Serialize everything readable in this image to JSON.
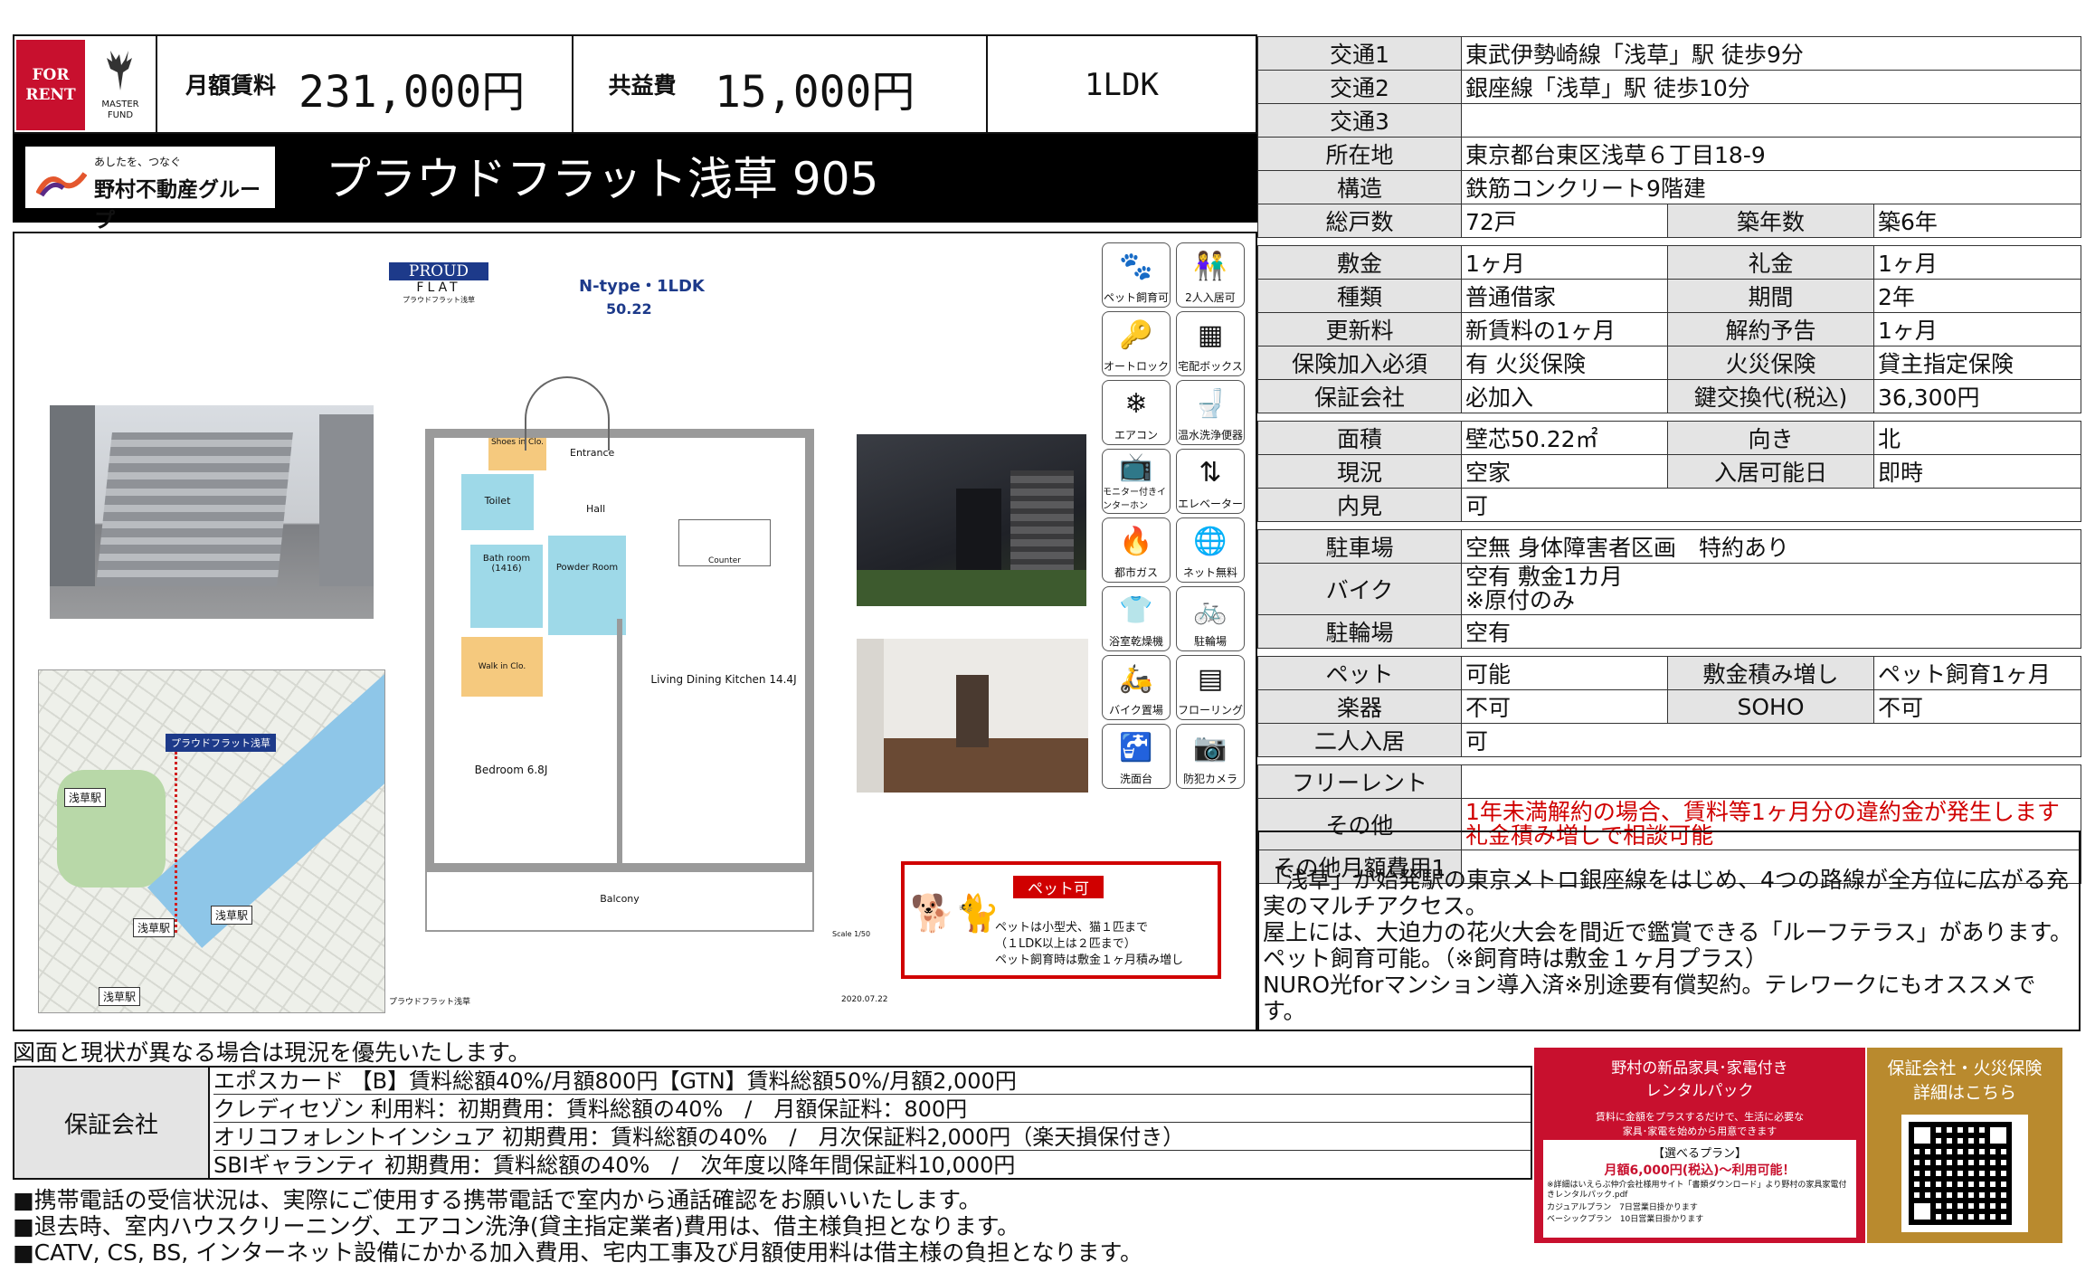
{
  "logo": {
    "for_rent": "FOR RENT",
    "brand": "MASTER FUND",
    "group_tag": "あしたを、つなぐ",
    "group_name": "野村不動産グループ"
  },
  "header": {
    "rent_label": "月額賃料",
    "rent_value": "231,000円",
    "fee_label": "共益費",
    "fee_value": "15,000円",
    "layout": "1LDK",
    "property_name": "プラウドフラット浅草 905"
  },
  "specs": {
    "top": [
      {
        "k": "交通1",
        "v": "東武伊勢崎線「浅草」駅 徒歩9分"
      },
      {
        "k": "交通2",
        "v": "銀座線「浅草」駅 徒歩10分"
      },
      {
        "k": "交通3",
        "v": ""
      },
      {
        "k": "所在地",
        "v": "東京都台東区浅草６丁目18-9"
      },
      {
        "k": "構造",
        "v": "鉄筋コンクリート9階建"
      }
    ],
    "units_label": "総戸数",
    "units_value": "72戸",
    "age_label": "築年数",
    "age_value": "築6年",
    "contract": [
      {
        "k1": "敷金",
        "v1": "1ヶ月",
        "k2": "礼金",
        "v2": "1ヶ月"
      },
      {
        "k1": "種類",
        "v1": "普通借家",
        "k2": "期間",
        "v2": "2年"
      },
      {
        "k1": "更新料",
        "v1": "新賃料の1ヶ月",
        "k2": "解約予告",
        "v2": "1ヶ月"
      },
      {
        "k1": "保険加入必須",
        "v1": "有 火災保険",
        "k2": "火災保険",
        "v2": "貸主指定保険"
      },
      {
        "k1": "保証会社",
        "v1": "必加入",
        "k2": "鍵交換代(税込)",
        "v2": "36,300円"
      }
    ],
    "room": [
      {
        "k1": "面積",
        "v1": "壁芯50.22㎡",
        "k2": "向き",
        "v2": "北"
      },
      {
        "k1": "現況",
        "v1": "空家",
        "k2": "入居可能日",
        "v2": "即時"
      }
    ],
    "viewing_label": "内見",
    "viewing_value": "可",
    "parking_label": "駐車場",
    "parking_value": "空無 身体障害者区画　特約あり",
    "bike_label": "バイク",
    "bike_value1": "空有 敷金1カ月",
    "bike_value2": "※原付のみ",
    "bicycle_label": "駐輪場",
    "bicycle_value": "空有",
    "pet_label": "ペット",
    "pet_value": "可能",
    "pet_deposit_label": "敷金積み増し",
    "pet_deposit_value": "ペット飼育1ヶ月",
    "instrument_label": "楽器",
    "instrument_value": "不可",
    "soho_label": "SOHO",
    "soho_value": "不可",
    "couple_label": "二人入居",
    "couple_value": "可",
    "freerent_label": "フリーレント",
    "freerent_value": "",
    "other_label": "その他",
    "other_value1": "1年未満解約の場合、賃料等1ヶ月分の違約金が発生します",
    "other_value2": "礼金積み増しで相談可能",
    "other_fee_label": "その他月額費用1"
  },
  "description": [
    "「浅草」が始発駅の東京メトロ銀座線をはじめ、4つの路線が全方位に広がる充実のマルチアクセス。",
    "屋上には、大迫力の花火大会を間近で鑑賞できる「ルーフテラス」があります。",
    "ペット飼育可能。（※飼育時は敷金１ヶ月プラス）",
    "NURO光forマンション導入済※別途要有償契約。テレワークにもオススメです。"
  ],
  "floorplan": {
    "brand": "PROUD",
    "brand2": "FLAT",
    "brand3": "プラウドフラット浅草",
    "type": "N-type・1LDK",
    "area": "50.22",
    "rooms": [
      "Shoes in Clo.",
      "Entrance",
      "Toilet",
      "Hall",
      "Bath room (1416)",
      "Powder Room",
      "Counter",
      "Walk in Clo.",
      "Living Dining Kitchen 14.4J",
      "Bedroom 6.8J",
      "Balcony"
    ],
    "scale": "Scale 1/50",
    "date": "2020.07.22",
    "caption": "プラウドフラット浅草",
    "map_label": "プラウドフラット浅草",
    "map_stations": [
      "浅草駅",
      "浅草駅",
      "浅草駅",
      "浅草駅"
    ]
  },
  "pet_box": {
    "title": "ペット可",
    "l1": "ペットは小型犬、猫１匹まで",
    "l2": "（１LDK以上は２匹まで）",
    "l3": "ペット飼育時は敷金１ヶ月積み増し"
  },
  "amenities": [
    {
      "label": "ペット飼育可",
      "icon": "pet-icon",
      "glyph": "🐾"
    },
    {
      "label": "2人入居可",
      "icon": "couple-icon",
      "glyph": "👫"
    },
    {
      "label": "オートロック",
      "icon": "key-icon",
      "glyph": "🔑"
    },
    {
      "label": "宅配ボックス",
      "icon": "parcel-box-icon",
      "glyph": "▦"
    },
    {
      "label": "エアコン",
      "icon": "aircon-icon",
      "glyph": "❄"
    },
    {
      "label": "温水洗浄便器",
      "icon": "toilet-icon",
      "glyph": "🚽"
    },
    {
      "label": "モニター付きインターホン",
      "icon": "intercom-icon",
      "glyph": "📺"
    },
    {
      "label": "エレベーター",
      "icon": "elevator-icon",
      "glyph": "⇅"
    },
    {
      "label": "都市ガス",
      "icon": "gas-icon",
      "glyph": "🔥"
    },
    {
      "label": "ネット無料",
      "icon": "internet-icon",
      "glyph": "🌐"
    },
    {
      "label": "浴室乾燥機",
      "icon": "bath-dryer-icon",
      "glyph": "👕"
    },
    {
      "label": "駐輪場",
      "icon": "bicycle-icon",
      "glyph": "🚲"
    },
    {
      "label": "バイク置場",
      "icon": "scooter-icon",
      "glyph": "🛵"
    },
    {
      "label": "フローリング",
      "icon": "flooring-icon",
      "glyph": "▤"
    },
    {
      "label": "洗面台",
      "icon": "washbasin-icon",
      "glyph": "🚰"
    },
    {
      "label": "防犯カメラ",
      "icon": "camera-icon",
      "glyph": "📷"
    }
  ],
  "disclaimer": "図面と現状が異なる場合は現況を優先いたします。",
  "guarantee": {
    "label": "保証会社",
    "rows": [
      "エポスカード 【B】賃料総額40%/月額800円【GTN】賃料総額50%/月額2,000円",
      "クレディセゾン 利用料：初期費用：賃料総額の40%　/　月額保証料：800円",
      "オリコフォレントインシュア 初期費用：賃料総額の40%　/　月次保証料2,000円（楽天損保付き）",
      "SBIギャランティ 初期費用：賃料総額の40%　/　次年度以降年間保証料10,000円"
    ]
  },
  "notes": [
    "■携帯電話の受信状況は、実際にご使用する携帯電話で室内から通話確認をお願いいたします。",
    "■退去時、室内ハウスクリーニング、エアコン洗浄(貸主指定業者)費用は、借主様負担となります。",
    "■CATV, CS, BS, インターネット設備にかかる加入費用、宅内工事及び月額使用料は借主様の負担となります。"
  ],
  "furniture_ad": {
    "t1": "野村の新品家具･家電付き",
    "t2": "レンタルパック",
    "d1": "賃料に金額をプラスするだけで、生活に必要な",
    "d2": "家具･家電を始めから用意できます",
    "plan": "【選べるプラン】",
    "price": "月額6,000円(税込)～利用可能！",
    "s1": "※詳細はいえらぶ仲介会社様用サイト「書類ダウンロード」より野村の家具家電付きレンタルパック.pdf",
    "s2": "カジュアルプラン　7日営業日掛かります",
    "s3": "ベーシックプラン　10日営業日掛かります"
  },
  "qr_box": {
    "l1": "保証会社・火災保険",
    "l2": "詳細はこちら"
  },
  "colors": {
    "red": "#c8102e",
    "gold": "#b98a2e",
    "key_bg": "#e4e4e4",
    "warn": "#d00000"
  }
}
